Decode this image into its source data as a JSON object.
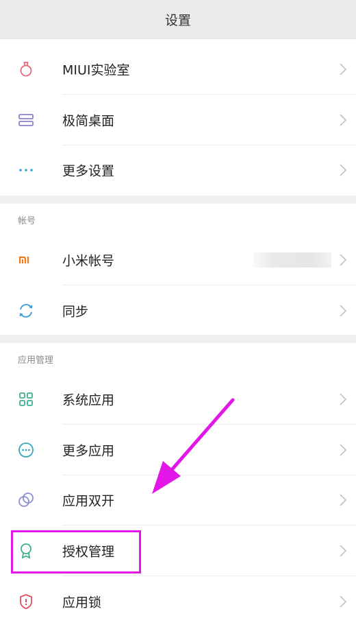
{
  "header": {
    "title": "设置"
  },
  "sections": {
    "account_label": "帐号",
    "apps_label": "应用管理"
  },
  "rows": {
    "miui_lab": "MIUI实验室",
    "simple_desktop": "极简桌面",
    "more_settings": "更多设置",
    "mi_account": "小米帐号",
    "sync": "同步",
    "system_apps": "系统应用",
    "more_apps": "更多应用",
    "dual_apps": "应用双开",
    "permissions": "授权管理",
    "app_lock": "应用锁"
  },
  "colors": {
    "highlight": "#e316e8",
    "arrow": "#e316e8"
  },
  "icons": {
    "miui_lab": "flask-icon",
    "simple_desktop": "layout-icon",
    "more_settings": "more-dots-icon",
    "mi_account": "mi-logo-icon",
    "sync": "sync-icon",
    "system_apps": "grid-icon",
    "more_apps": "more-circle-icon",
    "dual_apps": "dual-circle-icon",
    "permissions": "badge-icon",
    "app_lock": "shield-icon"
  }
}
